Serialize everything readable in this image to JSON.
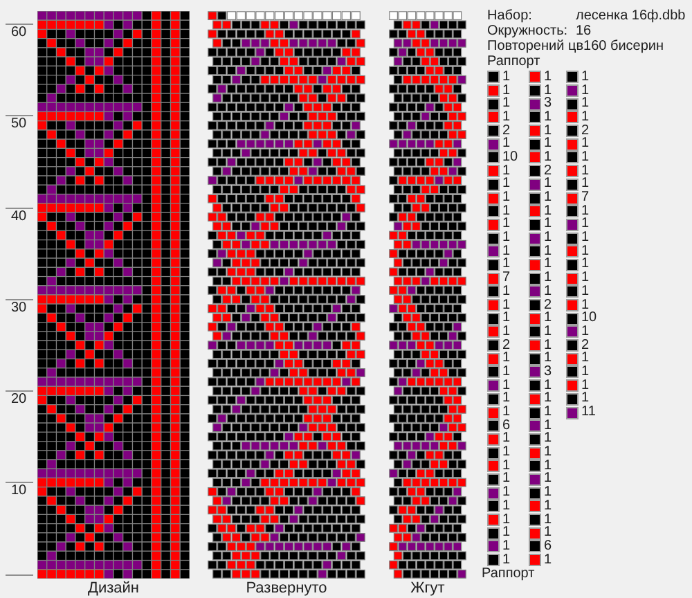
{
  "ruler_labels": [
    "60",
    "50",
    "40",
    "30",
    "20",
    "10"
  ],
  "views": [
    {
      "kind": "design",
      "label": "Дизайн"
    },
    {
      "kind": "unwrapped",
      "label": "Развернуто"
    },
    {
      "kind": "rope",
      "label": "Жгут"
    }
  ],
  "info": {
    "set_label": "Набор:",
    "set_value": "лесенка 16ф.dbb",
    "circumference_label": "Окружность:",
    "circumference_value": "16",
    "repeat_text": "Повторений цв160 бисерин",
    "rapport_heading": "Раппорт"
  },
  "rapport_columns": [
    [
      {
        "color": "#000000",
        "count": "1"
      },
      {
        "color": "#ff0000",
        "count": "1"
      },
      {
        "color": "#000000",
        "count": "1"
      },
      {
        "color": "#ff0000",
        "count": "1"
      },
      {
        "color": "#000000",
        "count": "2"
      },
      {
        "color": "#800080",
        "count": "1"
      },
      {
        "color": "#000000",
        "count": "10"
      },
      {
        "color": "#ff0000",
        "count": "1"
      },
      {
        "color": "#000000",
        "count": "1"
      },
      {
        "color": "#ff0000",
        "count": "1"
      },
      {
        "color": "#000000",
        "count": "1"
      },
      {
        "color": "#ff0000",
        "count": "1"
      },
      {
        "color": "#000000",
        "count": "1"
      },
      {
        "color": "#800080",
        "count": "1"
      },
      {
        "color": "#000000",
        "count": "1"
      },
      {
        "color": "#ff0000",
        "count": "7"
      },
      {
        "color": "#000000",
        "count": "1"
      },
      {
        "color": "#ff0000",
        "count": "1"
      },
      {
        "color": "#000000",
        "count": "1"
      },
      {
        "color": "#ff0000",
        "count": "1"
      },
      {
        "color": "#000000",
        "count": "2"
      },
      {
        "color": "#ff0000",
        "count": "1"
      },
      {
        "color": "#000000",
        "count": "1"
      },
      {
        "color": "#800080",
        "count": "1"
      },
      {
        "color": "#000000",
        "count": "1"
      },
      {
        "color": "#ff0000",
        "count": "1"
      },
      {
        "color": "#000000",
        "count": "6"
      },
      {
        "color": "#ff0000",
        "count": "1"
      },
      {
        "color": "#000000",
        "count": "1"
      },
      {
        "color": "#ff0000",
        "count": "1"
      },
      {
        "color": "#000000",
        "count": "1"
      },
      {
        "color": "#800080",
        "count": "1"
      },
      {
        "color": "#000000",
        "count": "1"
      },
      {
        "color": "#ff0000",
        "count": "1"
      },
      {
        "color": "#000000",
        "count": "1"
      },
      {
        "color": "#800080",
        "count": "1"
      },
      {
        "color": "#000000",
        "count": "1"
      }
    ],
    [
      {
        "color": "#ff0000",
        "count": "1"
      },
      {
        "color": "#000000",
        "count": "1"
      },
      {
        "color": "#800080",
        "count": "3"
      },
      {
        "color": "#000000",
        "count": "1"
      },
      {
        "color": "#ff0000",
        "count": "1"
      },
      {
        "color": "#000000",
        "count": "1"
      },
      {
        "color": "#ff0000",
        "count": "1"
      },
      {
        "color": "#000000",
        "count": "2"
      },
      {
        "color": "#800080",
        "count": "1"
      },
      {
        "color": "#000000",
        "count": "1"
      },
      {
        "color": "#ff0000",
        "count": "1"
      },
      {
        "color": "#000000",
        "count": "1"
      },
      {
        "color": "#800080",
        "count": "1"
      },
      {
        "color": "#000000",
        "count": "1"
      },
      {
        "color": "#ff0000",
        "count": "1"
      },
      {
        "color": "#000000",
        "count": "1"
      },
      {
        "color": "#800080",
        "count": "1"
      },
      {
        "color": "#000000",
        "count": "2"
      },
      {
        "color": "#ff0000",
        "count": "1"
      },
      {
        "color": "#000000",
        "count": "1"
      },
      {
        "color": "#ff0000",
        "count": "1"
      },
      {
        "color": "#000000",
        "count": "1"
      },
      {
        "color": "#800080",
        "count": "3"
      },
      {
        "color": "#000000",
        "count": "1"
      },
      {
        "color": "#ff0000",
        "count": "1"
      },
      {
        "color": "#000000",
        "count": "1"
      },
      {
        "color": "#800080",
        "count": "1"
      },
      {
        "color": "#000000",
        "count": "1"
      },
      {
        "color": "#ff0000",
        "count": "1"
      },
      {
        "color": "#000000",
        "count": "1"
      },
      {
        "color": "#800080",
        "count": "1"
      },
      {
        "color": "#000000",
        "count": "1"
      },
      {
        "color": "#ff0000",
        "count": "1"
      },
      {
        "color": "#000000",
        "count": "1"
      },
      {
        "color": "#ff0000",
        "count": "1"
      },
      {
        "color": "#000000",
        "count": "6"
      },
      {
        "color": "#ff0000",
        "count": "1"
      }
    ],
    [
      {
        "color": "#000000",
        "count": "1"
      },
      {
        "color": "#800080",
        "count": "1"
      },
      {
        "color": "#000000",
        "count": "1"
      },
      {
        "color": "#ff0000",
        "count": "1"
      },
      {
        "color": "#000000",
        "count": "2"
      },
      {
        "color": "#ff0000",
        "count": "1"
      },
      {
        "color": "#000000",
        "count": "1"
      },
      {
        "color": "#ff0000",
        "count": "1"
      },
      {
        "color": "#000000",
        "count": "1"
      },
      {
        "color": "#ff0000",
        "count": "7"
      },
      {
        "color": "#000000",
        "count": "1"
      },
      {
        "color": "#800080",
        "count": "1"
      },
      {
        "color": "#000000",
        "count": "1"
      },
      {
        "color": "#ff0000",
        "count": "1"
      },
      {
        "color": "#000000",
        "count": "1"
      },
      {
        "color": "#ff0000",
        "count": "1"
      },
      {
        "color": "#000000",
        "count": "1"
      },
      {
        "color": "#ff0000",
        "count": "1"
      },
      {
        "color": "#000000",
        "count": "10"
      },
      {
        "color": "#800080",
        "count": "1"
      },
      {
        "color": "#000000",
        "count": "2"
      },
      {
        "color": "#ff0000",
        "count": "1"
      },
      {
        "color": "#000000",
        "count": "1"
      },
      {
        "color": "#ff0000",
        "count": "1"
      },
      {
        "color": "#000000",
        "count": "1"
      },
      {
        "color": "#800080",
        "count": "11"
      }
    ]
  ],
  "rapport_label": "Раппорт"
}
